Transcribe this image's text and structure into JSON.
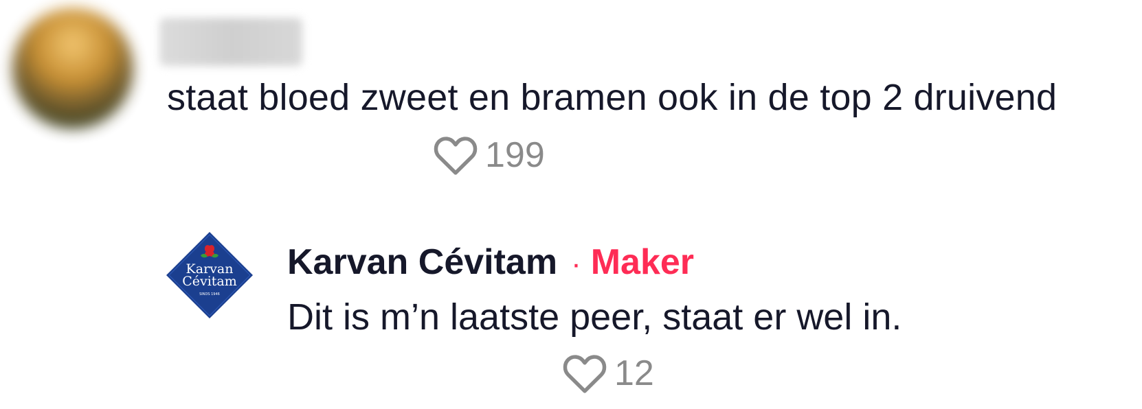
{
  "comment": {
    "text": "staat bloed zweet en bramen ook in de top 2 druivend",
    "likes": "199"
  },
  "reply": {
    "author": "Karvan Cévitam",
    "separator": "·",
    "badge": "Maker",
    "text": "Dit is m’n laatste peer, staat er wel in.",
    "likes": "12",
    "avatar_logo_line1": "Karvan",
    "avatar_logo_line2": "Cévitam",
    "avatar_logo_tagline": "SINDS 1946"
  },
  "colors": {
    "text": "#16182a",
    "accent": "#fe2c55",
    "muted": "#8a8a8a",
    "logo_blue": "#1b3f8f"
  },
  "icons": {
    "like": "heart-outline-icon"
  }
}
